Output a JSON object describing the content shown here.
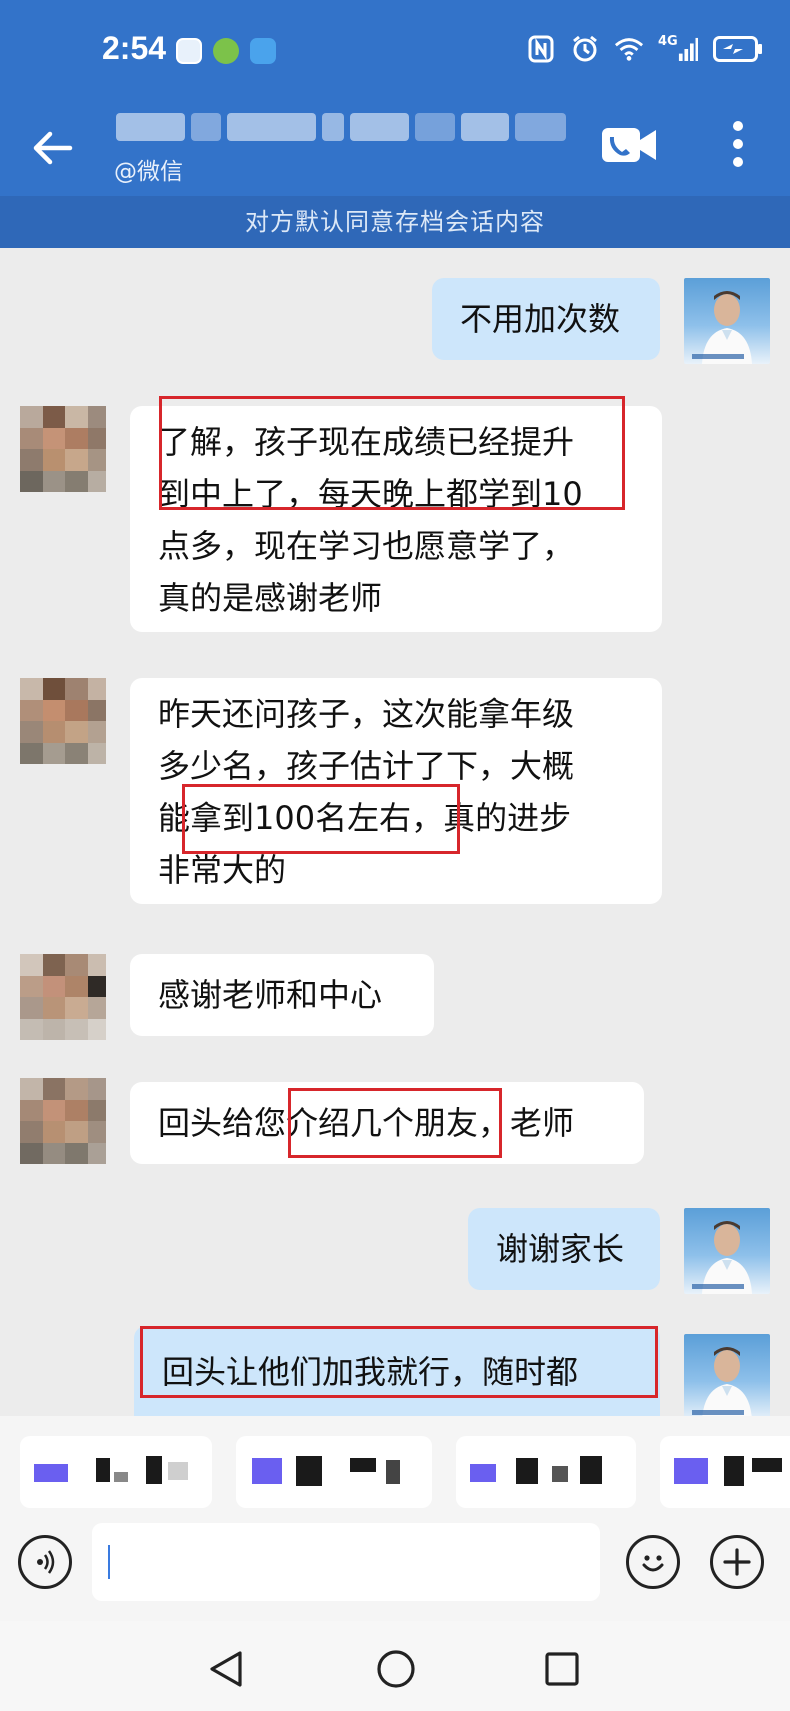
{
  "status_bar": {
    "time": "2:54",
    "network": "4G"
  },
  "header": {
    "title_redacted": true,
    "subtitle": "@微信"
  },
  "notice": "对方默认同意存档会话内容",
  "messages": [
    {
      "side": "me",
      "text": "不用加次数"
    },
    {
      "side": "them",
      "lines": [
        "了解，孩子现在成绩已经提升",
        "到中上了，每天晚上都学到10",
        "点多，现在学习也愿意学了，",
        "真的是感谢老师"
      ]
    },
    {
      "side": "them",
      "lines": [
        "昨天还问孩子，这次能拿年级",
        "多少名，孩子估计了下，大概",
        "能拿到100名左右，真的进步",
        "非常大的"
      ]
    },
    {
      "side": "them",
      "text": "感谢老师和中心"
    },
    {
      "side": "them",
      "text": "回头给您介绍几个朋友，老师"
    },
    {
      "side": "me",
      "text": "谢谢家长"
    },
    {
      "side": "me",
      "text": "回头让他们加我就行，随时都"
    }
  ],
  "colors": {
    "header": "#3373c9",
    "notice": "#2f68b8",
    "bubble_me": "#cde6fb",
    "bubble_them": "#ffffff",
    "highlight": "#d7262b",
    "background": "#ececec"
  },
  "icons": {
    "back": "arrow-left-icon",
    "video": "video-call-icon",
    "more": "more-vertical-icon",
    "voice": "voice-icon",
    "emoji": "emoji-icon",
    "plus": "plus-icon"
  }
}
